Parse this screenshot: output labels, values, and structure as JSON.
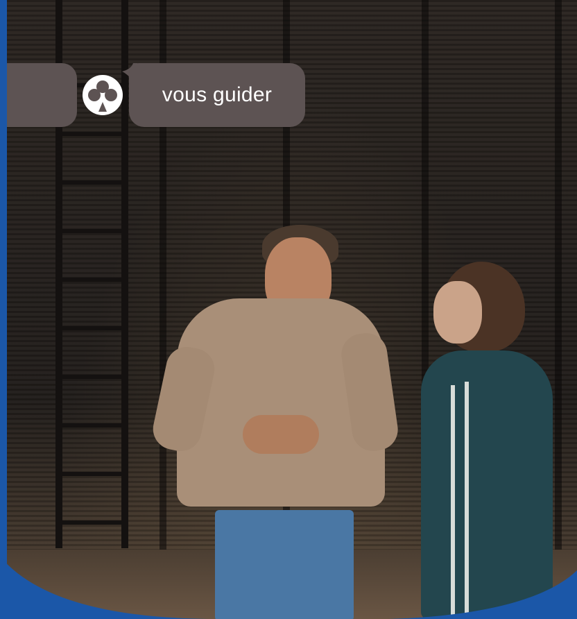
{
  "badge": {
    "text": "vous guider",
    "logo_icon": "person-symbol-icon"
  },
  "colors": {
    "brand_blue": "#1b57a8",
    "badge_bg": "#5d5353",
    "badge_text": "#ffffff"
  }
}
